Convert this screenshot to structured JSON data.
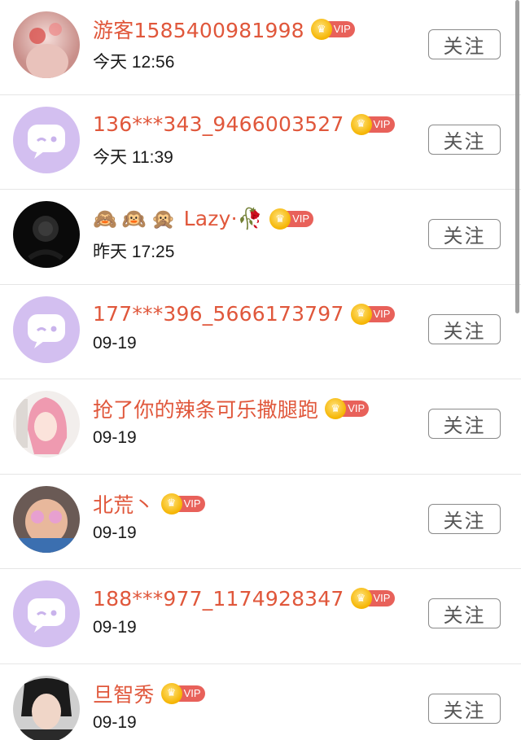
{
  "follow_label": "关注",
  "vip_label": "VIP",
  "accent_color": "#e0573b",
  "users": [
    {
      "name": "游客1585400981998",
      "time": "今天 12:56",
      "avatar": "photo-pink-flowers"
    },
    {
      "name": "136***343_9466003527",
      "time": "今天 11:39",
      "avatar": "default-chat-bubble"
    },
    {
      "emoji": "🙈🙉🙊",
      "name": "Lazy·🥀",
      "time": "昨天 17:25",
      "avatar": "black-rose"
    },
    {
      "name": "177***396_5666173797",
      "time": "09-19",
      "avatar": "default-chat-bubble"
    },
    {
      "name": "抢了你的辣条可乐撒腿跑",
      "time": "09-19",
      "avatar": "anime-pink-hair"
    },
    {
      "name": "北荒丶",
      "time": "09-19",
      "avatar": "child-photo"
    },
    {
      "name": "188***977_1174928347",
      "time": "09-19",
      "avatar": "default-chat-bubble"
    },
    {
      "name": "旦智秀",
      "time": "09-19",
      "avatar": "portrait-photo"
    }
  ]
}
